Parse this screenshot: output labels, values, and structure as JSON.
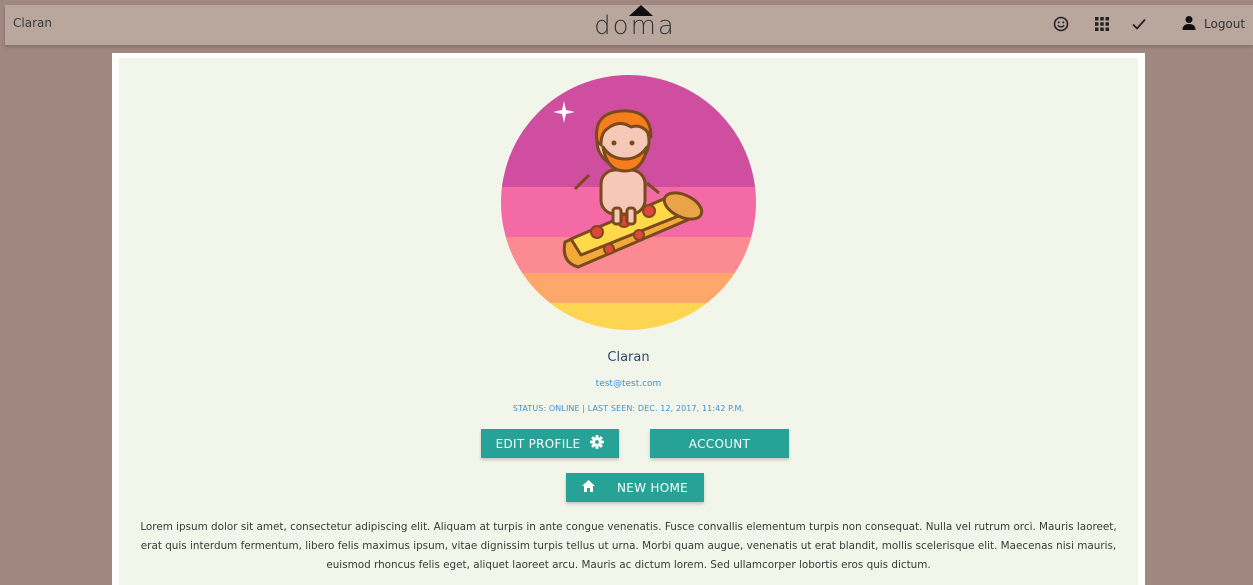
{
  "topbar": {
    "user_name": "Claran",
    "brand": "doma",
    "icons": [
      "smiley-icon",
      "grid-icon",
      "checkmark-icon",
      "person-icon"
    ],
    "logout_label": "Logout"
  },
  "profile": {
    "name": "Claran",
    "email": "test@test.com",
    "status": "STATUS: ONLINE | LAST SEEN: DEC. 12, 2017, 11:42 P.M.",
    "edit_profile_label": "EDIT PROFILE",
    "account_label": "ACCOUNT",
    "new_home_label": "NEW HOME",
    "bio": "Lorem ipsum dolor sit amet, consectetur adipiscing elit. Aliquam at turpis in ante congue venenatis. Fusce convallis elementum turpis non consequat. Nulla vel rutrum orci. Mauris laoreet, erat quis interdum fermentum, libero felis maximus ipsum, vitae dignissim turpis tellus ut urna. Morbi quam augue, venenatis ut erat blandit, mollis scelerisque elit. Maecenas nisi mauris, euismod rhoncus felis eget, aliquet laoreet arcu. Mauris ac dictum lorem. Sed ullamcorper lobortis eros quis dictum."
  },
  "colors": {
    "background": "#a08780",
    "topbar": "#b9a79e",
    "card": "#f2f6ea",
    "accent": "#27a296",
    "link": "#3f8fd0"
  }
}
